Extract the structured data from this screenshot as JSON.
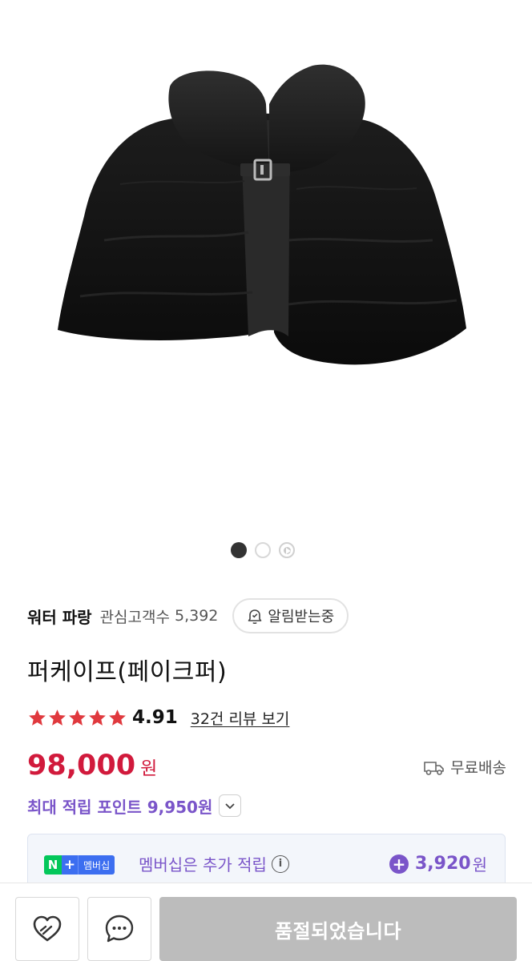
{
  "gallery": {
    "image_alt": "퍼케이프 제품 이미지",
    "pages": 3,
    "current_page": 1
  },
  "store": {
    "name": "워터 파랑",
    "fav_label": "관심고객수",
    "fav_count": "5,392",
    "notify_label": "알림받는중"
  },
  "product": {
    "title": "퍼케이프(페이크퍼)"
  },
  "rating": {
    "stars": 5,
    "value": "4.91",
    "review_link": "32건 리뷰 보기"
  },
  "price": {
    "amount": "98,000",
    "currency": "원",
    "shipping": "무료배송"
  },
  "points": {
    "label": "최대 적립 포인트 9,950원"
  },
  "membership": {
    "badge_n": "N",
    "badge_plus": "+",
    "badge_text": "멤버십",
    "text": "멤버십은 추가 적립",
    "info": "i",
    "points_value": "3,920",
    "points_unit": "원"
  },
  "bottom_bar": {
    "soldout_label": "품절되었습니다"
  },
  "colors": {
    "price_red": "#d11a3c",
    "purple": "#7a55c9",
    "star_red": "#e0393e",
    "naver_green": "#03c75a",
    "disabled_gray": "#bcbcbc"
  }
}
